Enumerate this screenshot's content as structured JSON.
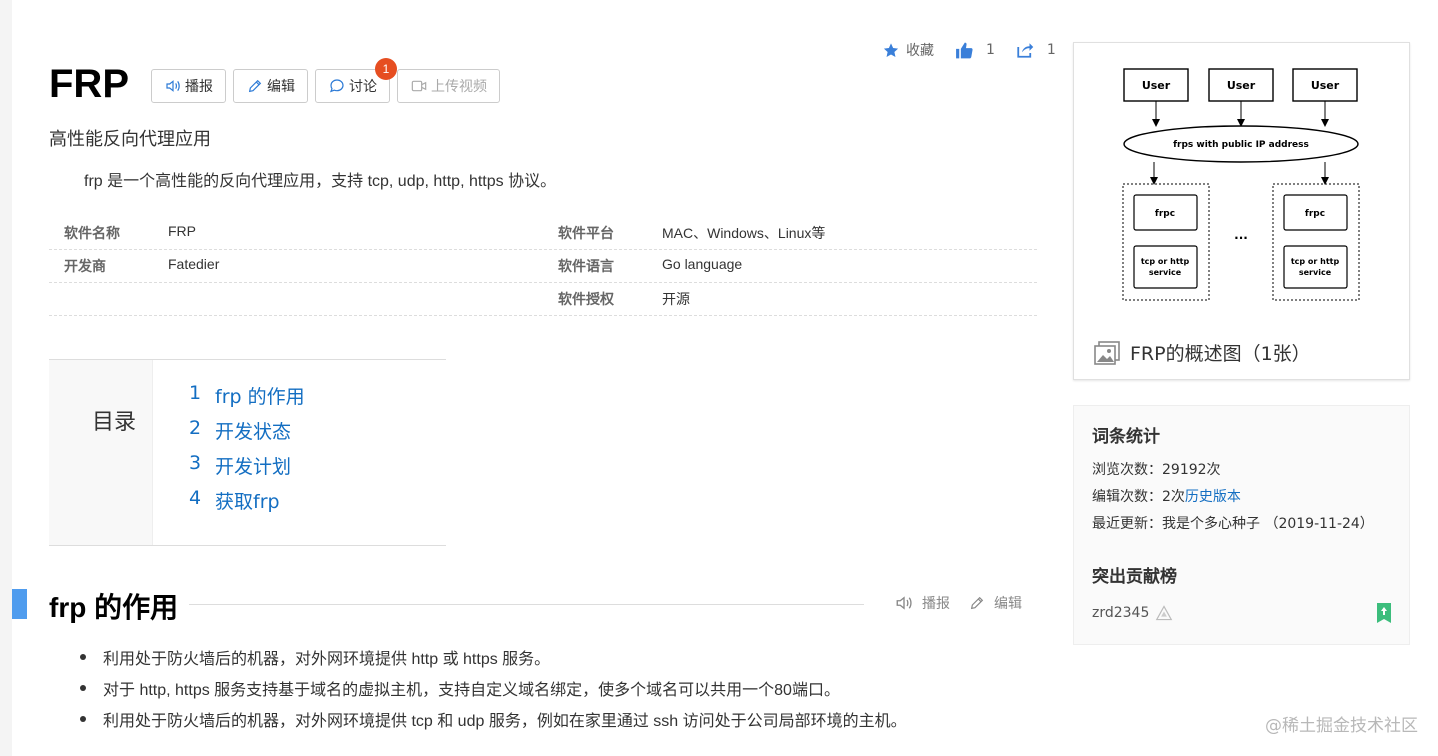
{
  "header": {
    "title": "FRP",
    "subtitle": "高性能反向代理应用",
    "summary": "frp 是一个高性能的反向代理应用，支持 tcp, udp, http, https 协议。",
    "buttons": {
      "broadcast": "播报",
      "edit": "编辑",
      "discuss": "讨论",
      "discuss_badge": "1",
      "upload_video": "上传视频"
    },
    "actions": {
      "favorite": "收藏",
      "like_count": "1",
      "share_count": "1"
    }
  },
  "info": {
    "left": [
      {
        "key": "软件名称",
        "value": "FRP"
      },
      {
        "key": "开发商",
        "value": "Fatedier"
      },
      {
        "key": "",
        "value": ""
      }
    ],
    "right": [
      {
        "key": "软件平台",
        "value": "MAC、Windows、Linux等"
      },
      {
        "key": "软件语言",
        "value": "Go language"
      },
      {
        "key": "软件授权",
        "value": "开源"
      }
    ]
  },
  "toc": {
    "title": "目录",
    "items": [
      {
        "num": "1",
        "label": "frp 的作用"
      },
      {
        "num": "2",
        "label": "开发状态"
      },
      {
        "num": "3",
        "label": "开发计划"
      },
      {
        "num": "4",
        "label": "获取frp"
      }
    ]
  },
  "section": {
    "title": "frp 的作用",
    "broadcast": "播报",
    "edit": "编辑",
    "bullets": [
      "利用处于防火墙后的机器，对外网环境提供 http 或 https 服务。",
      "对于 http, https 服务支持基于域名的虚拟主机，支持自定义域名绑定，使多个域名可以共用一个80端口。",
      "利用处于防火墙后的机器，对外网环境提供 tcp 和 udp 服务，例如在家里通过 ssh 访问处于公司局部环境的主机。"
    ]
  },
  "album": {
    "caption": "FRP的概述图（1张）",
    "diagram": {
      "users": [
        "User",
        "User",
        "User"
      ],
      "server": "frps with public IP address",
      "client": "frpc",
      "service": [
        "tcp or http",
        "service"
      ],
      "ellipsis": "..."
    }
  },
  "stats": {
    "title": "词条统计",
    "views_label": "浏览次数：",
    "views_value": "29192次",
    "edits_label": "编辑次数：",
    "edits_value": "2次",
    "history_link": "历史版本",
    "updated_label": "最近更新：",
    "updated_value": "我是个多心种子 （2019-11-24）",
    "contrib_title": "突出贡献榜",
    "contributor": "zrd2345"
  },
  "watermark": "@稀土掘金技术社区",
  "colors": {
    "accent": "#136ec2",
    "section_bar": "#4f9cee",
    "badge": "#e64e21",
    "like": "#3a7fd9"
  }
}
